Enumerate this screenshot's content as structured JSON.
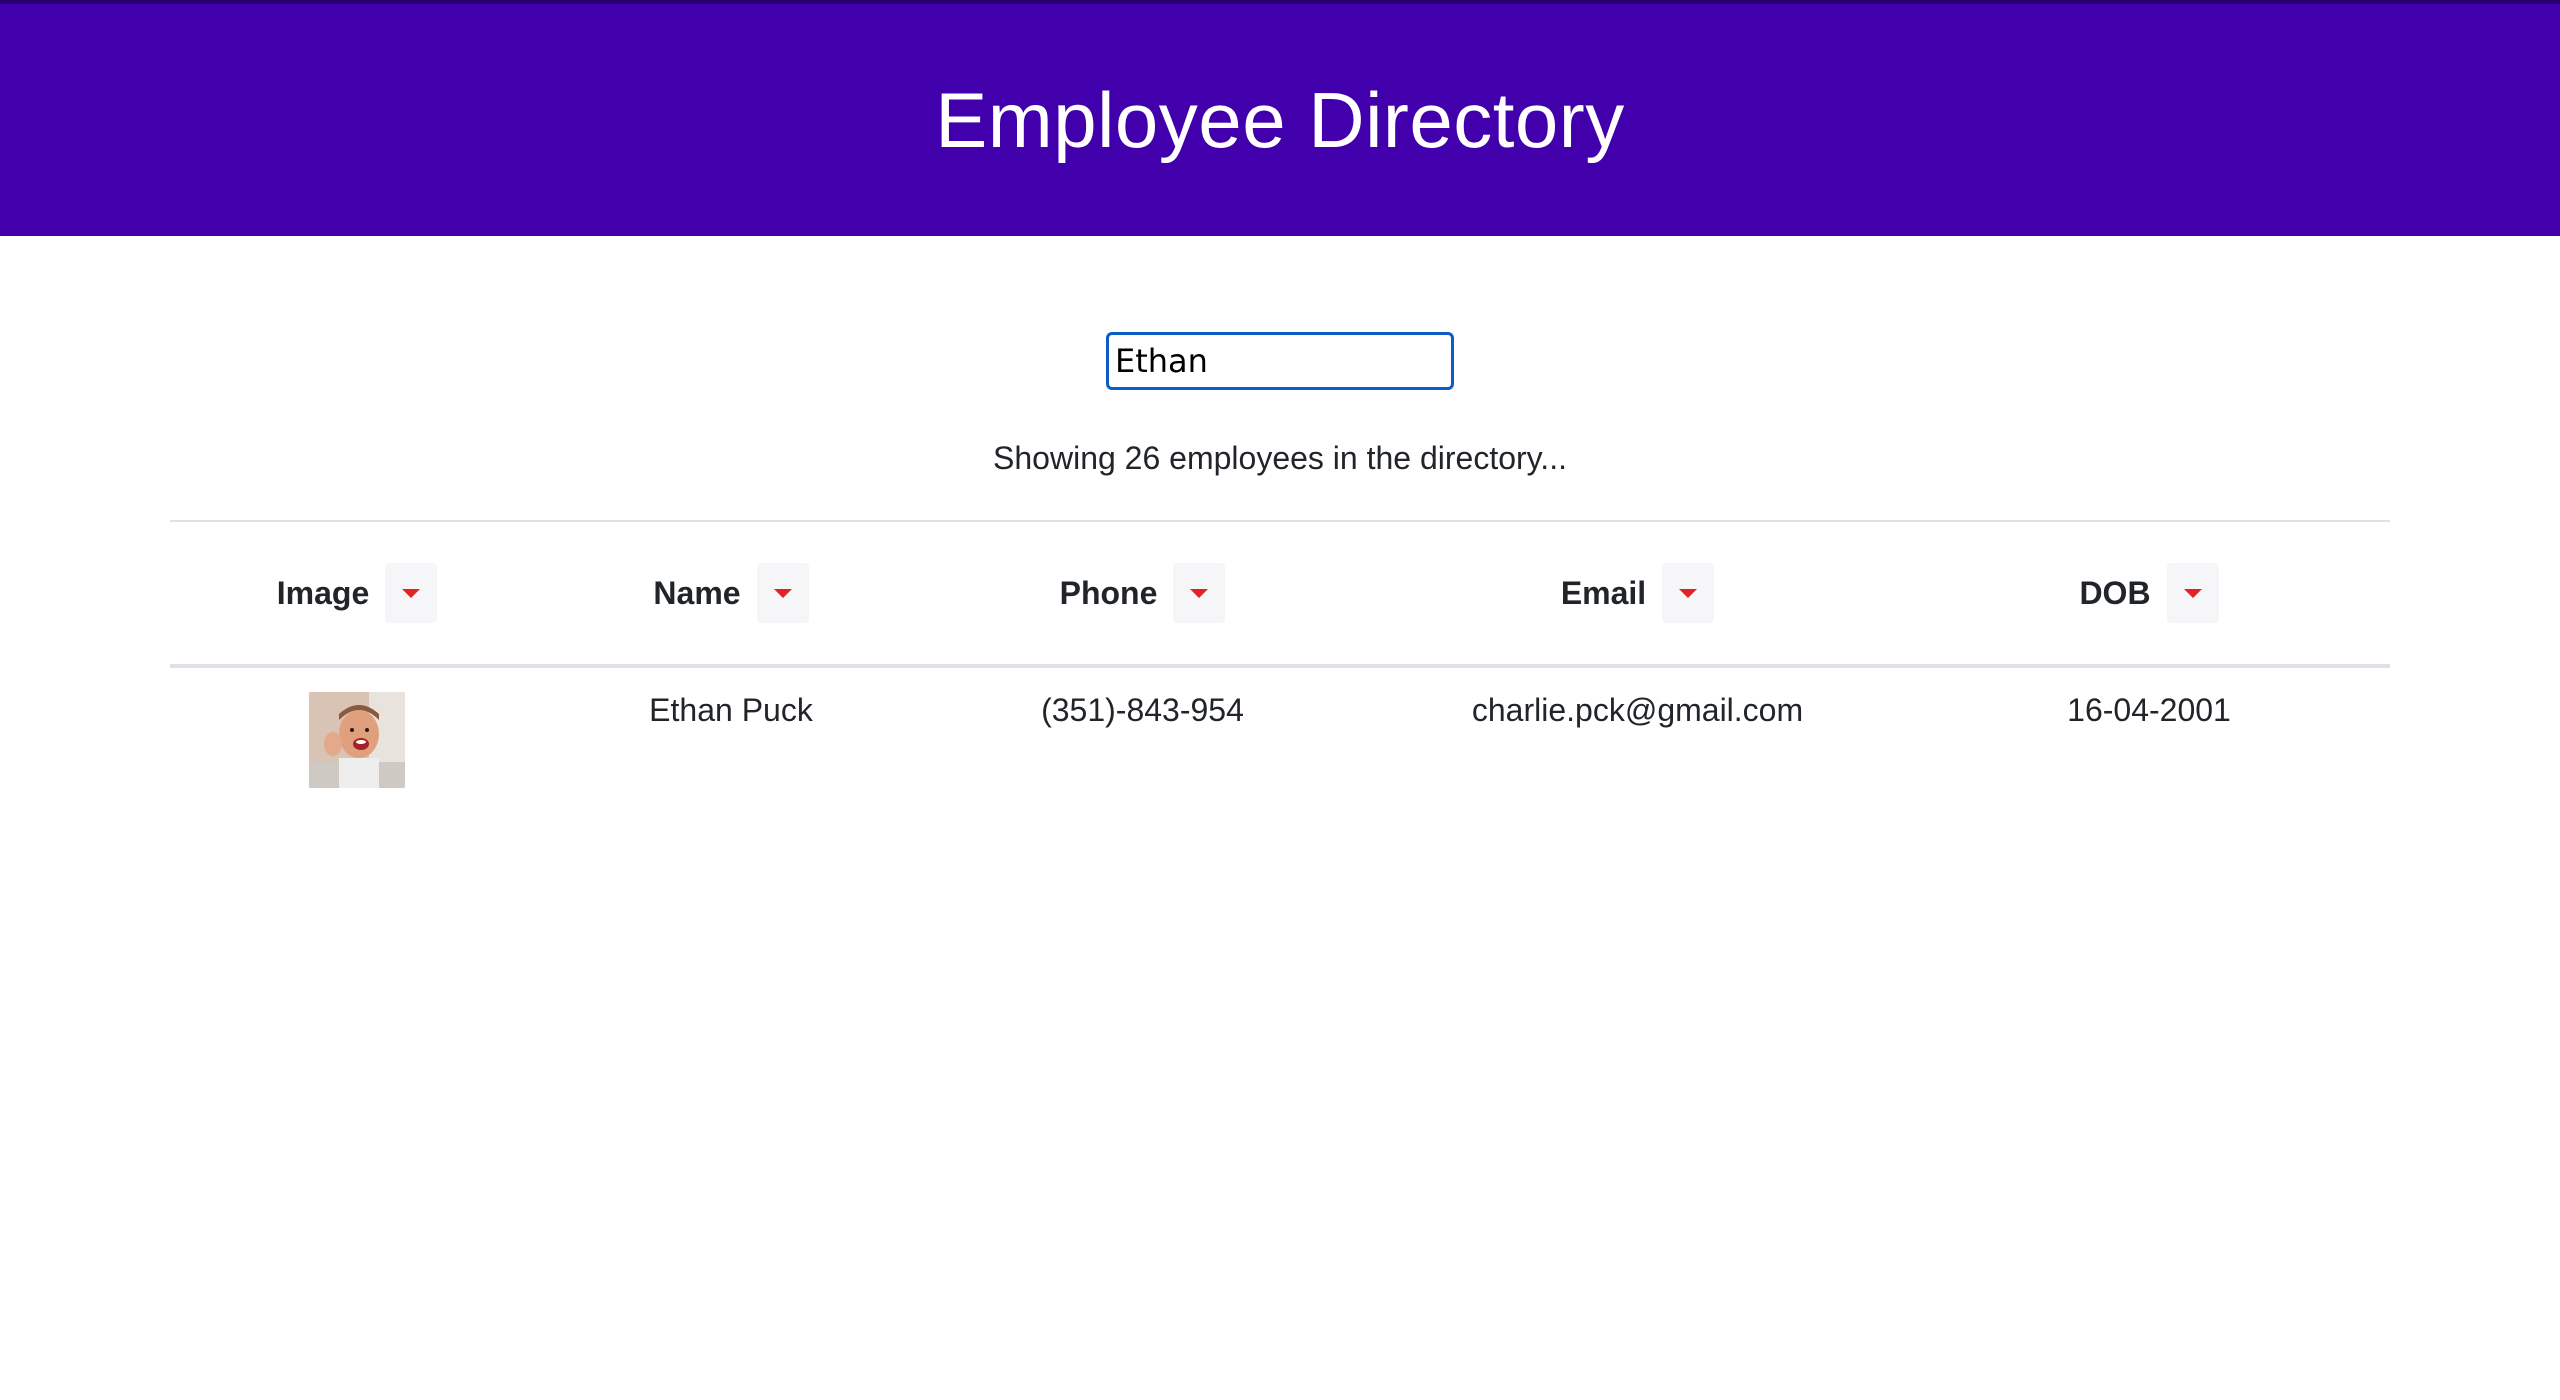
{
  "header": {
    "title": "Employee Directory"
  },
  "search": {
    "value": "Ethan"
  },
  "status": {
    "text": "Showing 26 employees in the directory..."
  },
  "table": {
    "columns": [
      {
        "label": "Image"
      },
      {
        "label": "Name"
      },
      {
        "label": "Phone"
      },
      {
        "label": "Email"
      },
      {
        "label": "DOB"
      }
    ],
    "rows": [
      {
        "name": "Ethan Puck",
        "phone": "(351)-843-954",
        "email": "charlie.pck@gmail.com",
        "dob": "16-04-2001"
      }
    ]
  },
  "colors": {
    "header_bg": "#4200ad",
    "sort_caret": "#e02424",
    "input_focus_border": "#0b5cc9"
  },
  "icons": {
    "sort": "caret-down-icon"
  }
}
